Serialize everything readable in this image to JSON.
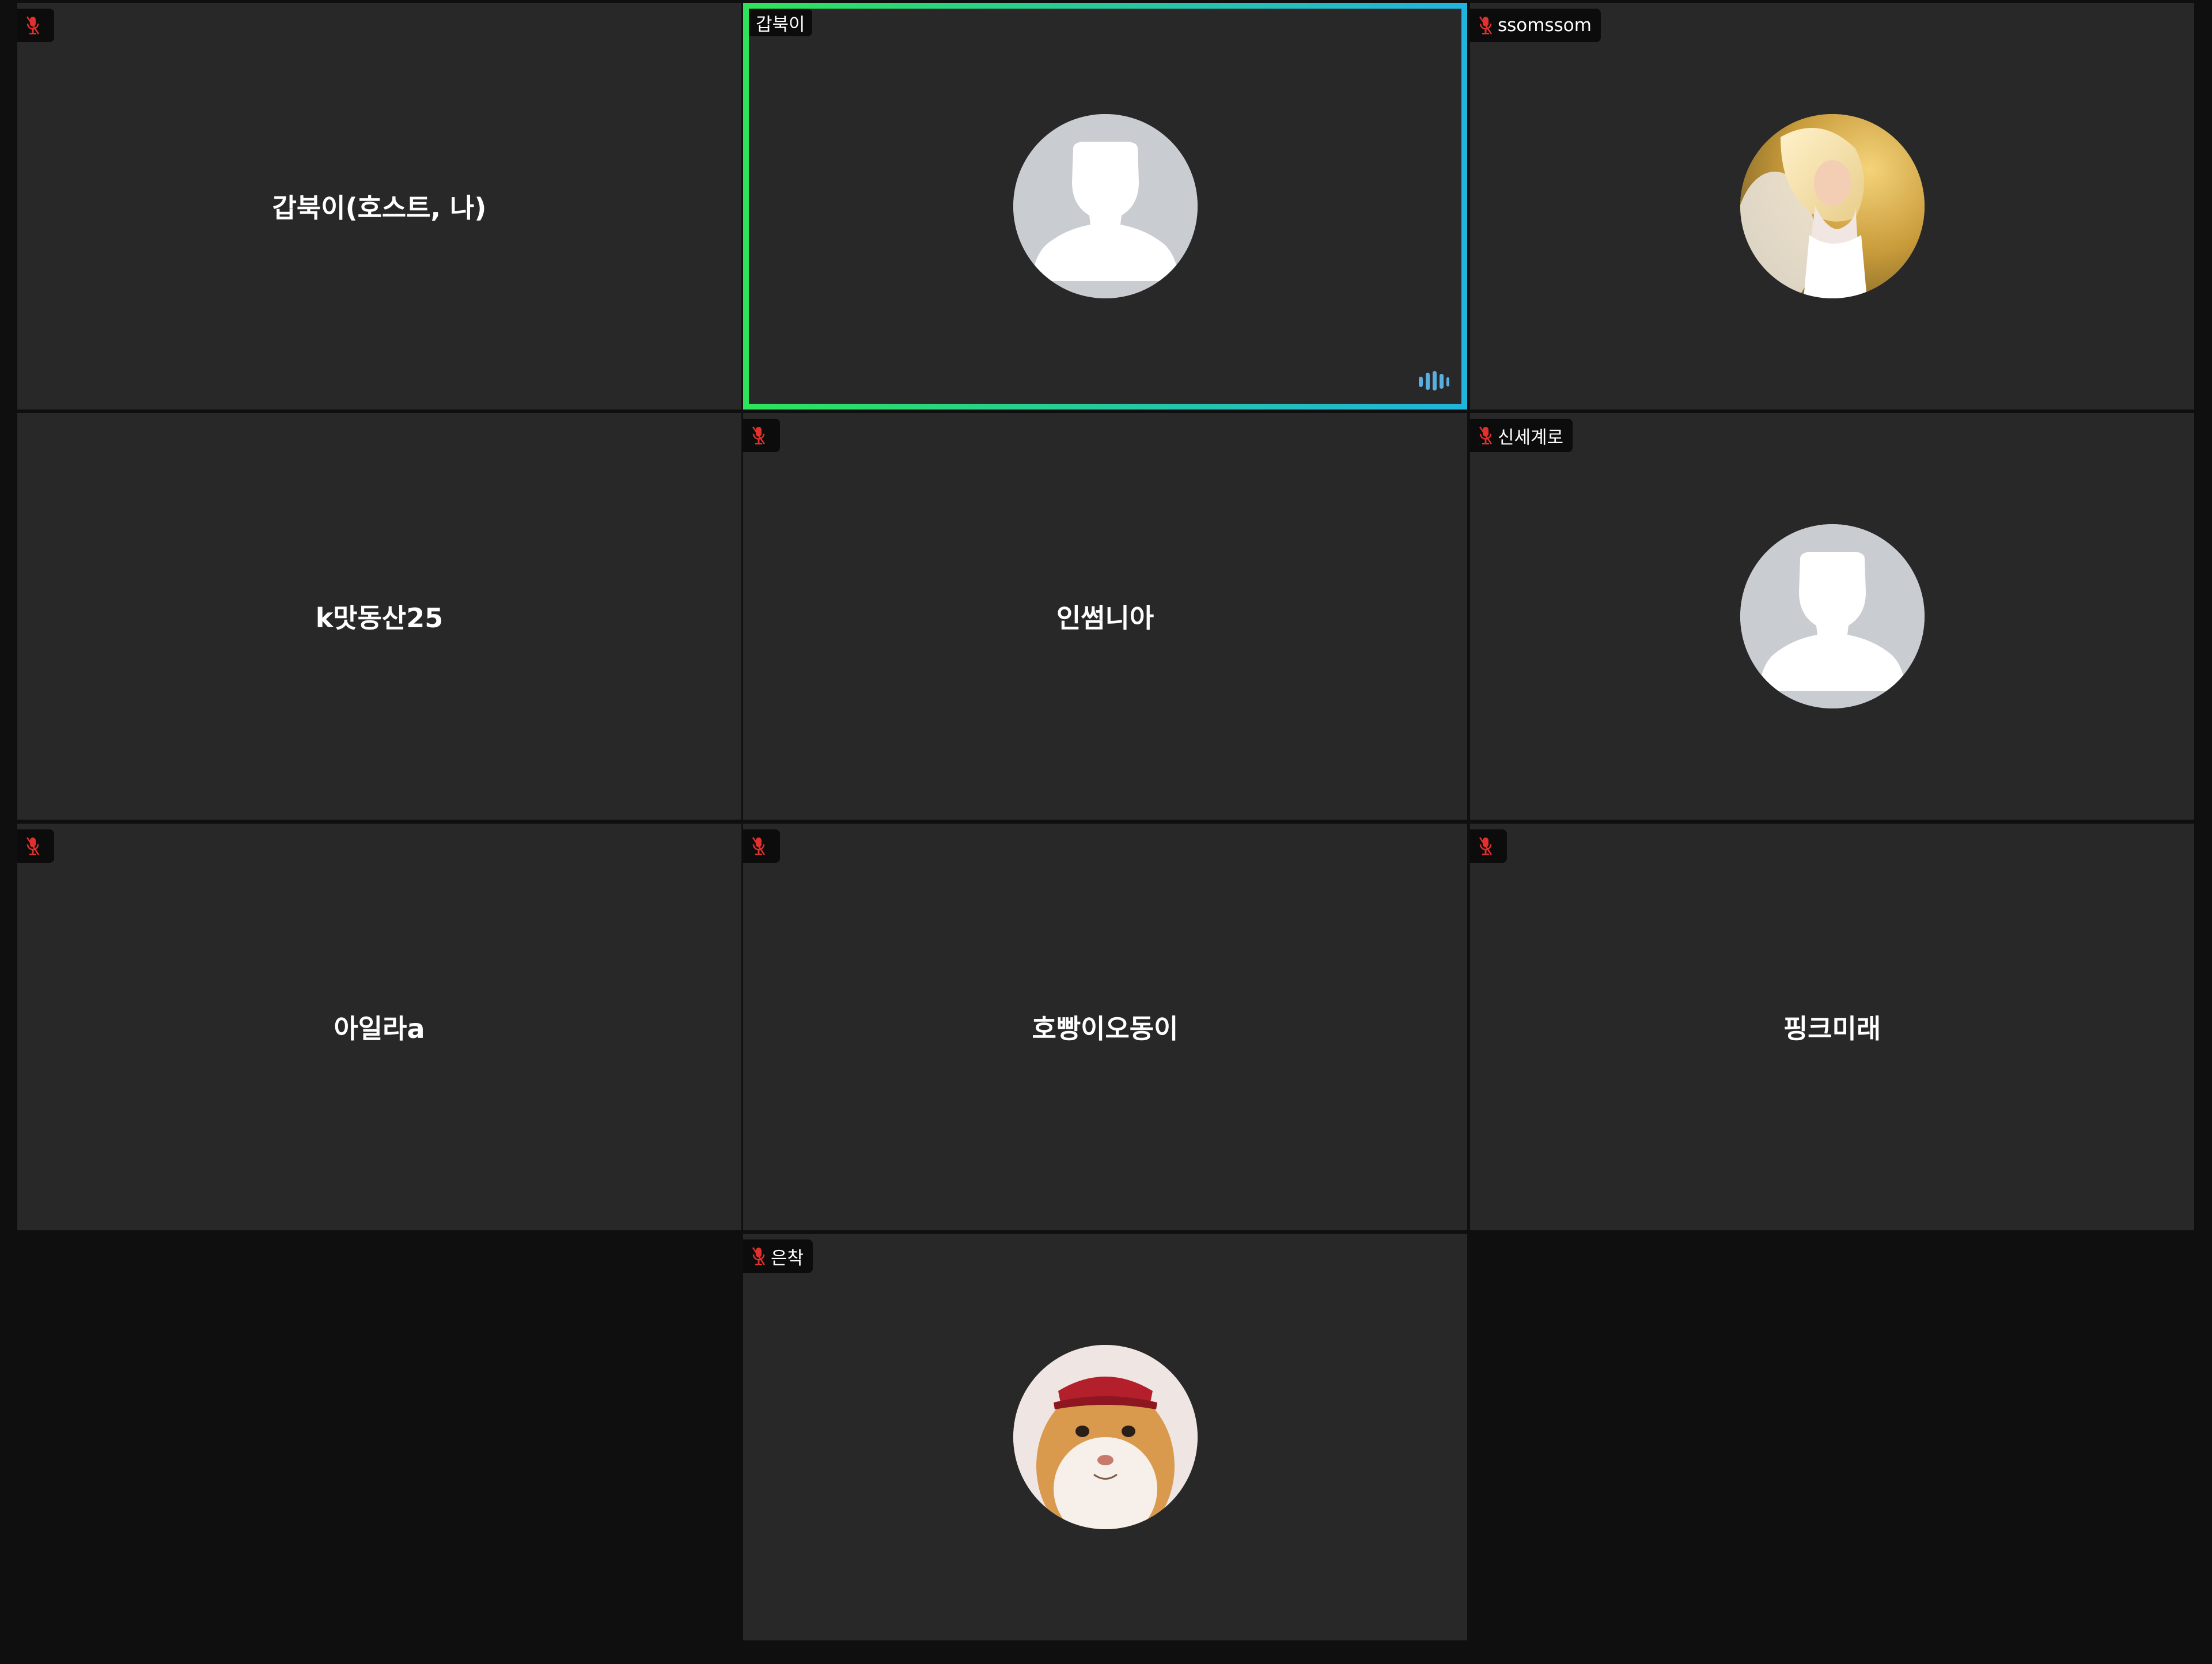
{
  "meeting": {
    "participants": [
      {
        "id": "p1",
        "display_name": "갑북이(호스트, 나)",
        "tag": "",
        "muted": true,
        "avatar": "none"
      },
      {
        "id": "p2",
        "display_name": "",
        "tag": "갑북이",
        "muted": false,
        "speaking": true,
        "avatar": "default-silhouette"
      },
      {
        "id": "p3",
        "display_name": "",
        "tag": "ssomssom",
        "muted": true,
        "avatar": "photo-girl"
      },
      {
        "id": "p4",
        "display_name": "k맛동산25",
        "tag": "",
        "muted": false,
        "avatar": "none"
      },
      {
        "id": "p5",
        "display_name": "인썸니아",
        "tag": "",
        "muted": true,
        "avatar": "none"
      },
      {
        "id": "p6",
        "display_name": "",
        "tag": "신세계로",
        "muted": true,
        "avatar": "default-silhouette"
      },
      {
        "id": "p7",
        "display_name": "아일라a",
        "tag": "",
        "muted": true,
        "avatar": "none"
      },
      {
        "id": "p8",
        "display_name": "호빵이오동이",
        "tag": "",
        "muted": true,
        "avatar": "none"
      },
      {
        "id": "p9",
        "display_name": "핑크미래",
        "tag": "",
        "muted": true,
        "avatar": "none"
      },
      {
        "id": "p10",
        "display_name": "",
        "tag": "은착",
        "muted": true,
        "avatar": "photo-cat"
      }
    ]
  },
  "colors": {
    "background": "#0f0f0f",
    "tile": "#282828",
    "speaking_border_start": "#2ee35a",
    "speaking_border_end": "#22b3dd",
    "muted_mic": "#e0312d",
    "audio_indicator": "#5aaee0",
    "avatar_bg": "#c9ccd1"
  },
  "icons": {
    "muted": "microphone-muted-icon",
    "audio": "audio-level-icon",
    "avatar_default": "user-silhouette-icon"
  }
}
